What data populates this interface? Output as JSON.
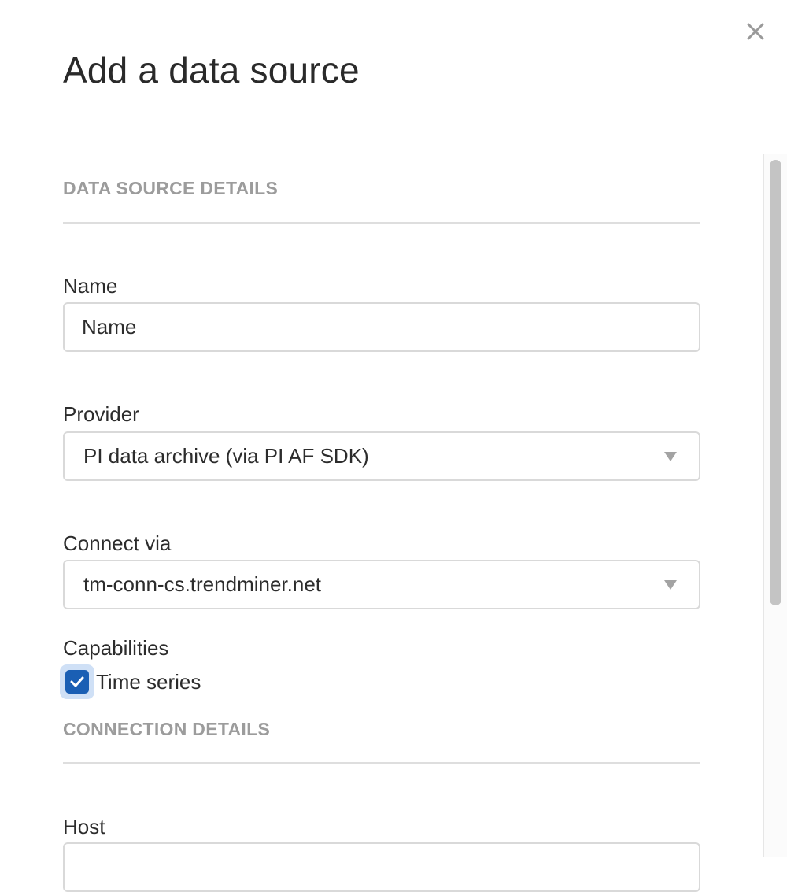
{
  "dialog": {
    "title": "Add a data source",
    "close_icon": "close-icon"
  },
  "sections": {
    "data_source_details": "DATA SOURCE DETAILS",
    "connection_details": "CONNECTION DETAILS"
  },
  "fields": {
    "name": {
      "label": "Name",
      "placeholder": "Name",
      "value": ""
    },
    "provider": {
      "label": "Provider",
      "value": "PI data archive (via PI AF SDK)"
    },
    "connect_via": {
      "label": "Connect via",
      "value": "tm-conn-cs.trendminer.net"
    },
    "capabilities": {
      "label": "Capabilities",
      "options": [
        {
          "label": "Time series",
          "checked": true
        }
      ]
    },
    "host": {
      "label": "Host",
      "value": ""
    }
  },
  "colors": {
    "accent": "#1a5fb4",
    "focus_ring": "#cfe0f6",
    "section_heading": "#9c9c9c",
    "border": "#d9d9d9"
  }
}
